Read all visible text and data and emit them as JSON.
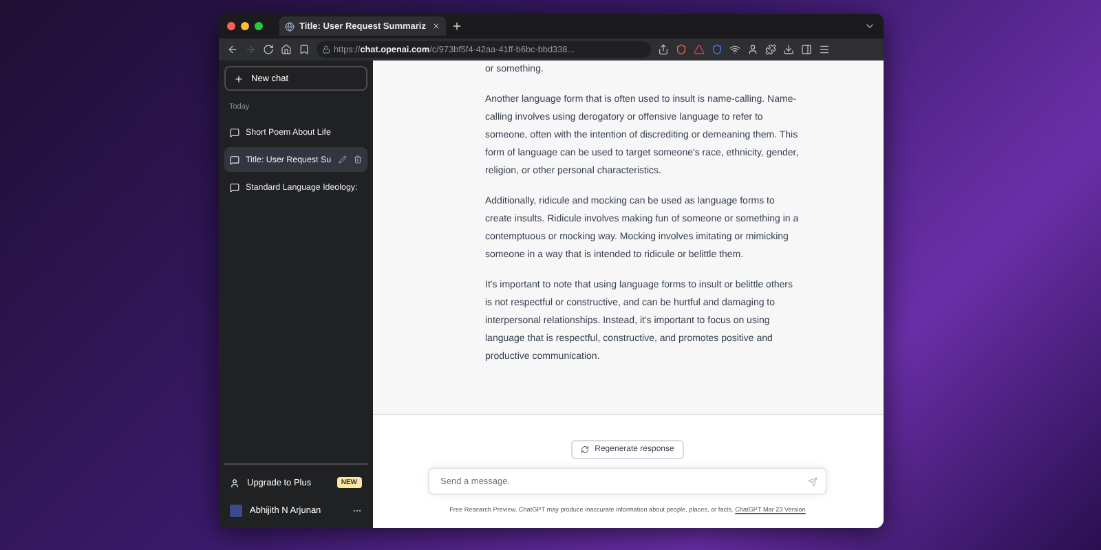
{
  "window": {
    "tab_title": "Title: User Request Summariz",
    "url": "https://**chat.openai.com**/c/973bf5f4-42aa-41ff-b6bc-bbd338..."
  },
  "toolbar": {
    "forward_disabled": true
  },
  "sidebar": {
    "new_chat": "New chat",
    "section": "Today",
    "chats": [
      {
        "title": "Short Poem About Life",
        "selected": false
      },
      {
        "title": "Title: User Request Su",
        "selected": true
      },
      {
        "title": "Standard Language Ideology:",
        "selected": false
      }
    ],
    "upgrade": {
      "label": "Upgrade to Plus",
      "badge": "NEW"
    },
    "user": {
      "name": "Abhijith N Arjunan"
    }
  },
  "conversation": {
    "paragraphs": [
      "or something.",
      "Another language form that is often used to insult is name-calling. Name-calling involves using derogatory or offensive language to refer to someone, often with the intention of discrediting or demeaning them. This form of language can be used to target someone's race, ethnicity, gender, religion, or other personal characteristics.",
      "Additionally, ridicule and mocking can be used as language forms to create insults. Ridicule involves making fun of someone or something in a contemptuous or mocking way. Mocking involves imitating or mimicking someone in a way that is intended to ridicule or belittle them.",
      "It's important to note that using language forms to insult or belittle others is not respectful or constructive, and can be hurtful and damaging to interpersonal relationships. Instead, it's important to focus on using language that is respectful, constructive, and promotes positive and productive communication."
    ]
  },
  "composer": {
    "regenerate": "Regenerate response",
    "placeholder": "Send a message.",
    "disclaimer": "Free Research Preview. ChatGPT may produce inaccurate information about people, places, or facts.",
    "version_link": "ChatGPT Mar 23 Version"
  }
}
